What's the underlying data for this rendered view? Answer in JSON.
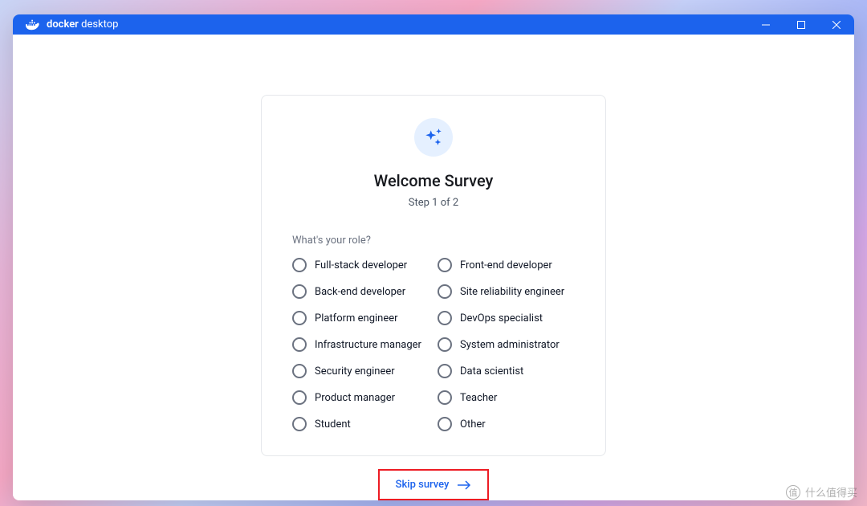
{
  "titlebar": {
    "brand_bold": "docker",
    "brand_light": "desktop"
  },
  "survey": {
    "title": "Welcome Survey",
    "step_text": "Step 1 of 2",
    "question": "What's your role?",
    "options_col1": [
      "Full-stack developer",
      "Back-end developer",
      "Platform engineer",
      "Infrastructure manager",
      "Security engineer",
      "Product manager",
      "Student"
    ],
    "options_col2": [
      "Front-end developer",
      "Site reliability engineer",
      "DevOps specialist",
      "System administrator",
      "Data scientist",
      "Teacher",
      "Other"
    ],
    "skip_label": "Skip survey"
  },
  "watermark": "什么值得买"
}
